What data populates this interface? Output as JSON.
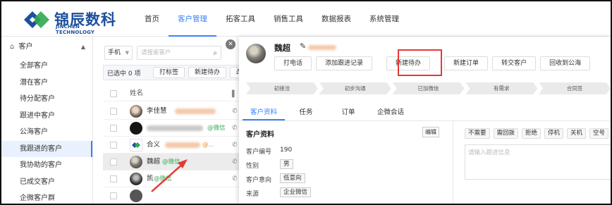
{
  "brand": {
    "name": "锦辰数科",
    "sub": "JINCHEN TECHNOLOGY"
  },
  "nav": [
    "首页",
    "客户管理",
    "拓客工具",
    "销售工具",
    "数据报表",
    "系统管理"
  ],
  "sidebar": {
    "section": "客户",
    "items": [
      "全部客户",
      "潜在客户",
      "待分配客户",
      "跟进中客户",
      "公海客户",
      "我跟进的客户",
      "我协助的客户",
      "已成交客户",
      "企微客户群"
    ]
  },
  "list": {
    "filter_select": "手机",
    "search_placeholder": "请搜索客户",
    "selected_text": "已选中 0 项",
    "bulk": [
      "打标签",
      "新建待办",
      "改"
    ],
    "col_name": "姓名",
    "rows": [
      {
        "name": "李佳慧",
        "suffix": ""
      },
      {
        "name": "",
        "suffix": "@微信"
      },
      {
        "name": "合义",
        "suffix": "@..."
      },
      {
        "name": "魏超",
        "suffix": "@微信"
      },
      {
        "name": "凯",
        "suffix": "@微信"
      }
    ]
  },
  "detail": {
    "name": "魏超",
    "edit_icon": "✎",
    "actions": [
      "打电话",
      "添加跟进记录",
      "新建待办",
      "新建订单",
      "转交客户",
      "回收到公海"
    ],
    "stages": [
      "初接洽",
      "初步沟通",
      "已加微信",
      "有需求",
      "合同签"
    ],
    "tabs": [
      "客户资料",
      "任务",
      "订单",
      "企微会话"
    ],
    "info_title": "客户资料",
    "edit_label": "编辑",
    "fields": [
      {
        "k": "客户编号",
        "v": "190"
      },
      {
        "k": "性别",
        "v": "男"
      },
      {
        "k": "客户意向",
        "v": "低意向"
      },
      {
        "k": "来源",
        "v": "企业微信"
      }
    ],
    "quick_tags": [
      "不需要",
      "需回拨",
      "拒绝",
      "停机",
      "关机",
      "空号"
    ],
    "follow_placeholder": "请输入跟进信息"
  }
}
